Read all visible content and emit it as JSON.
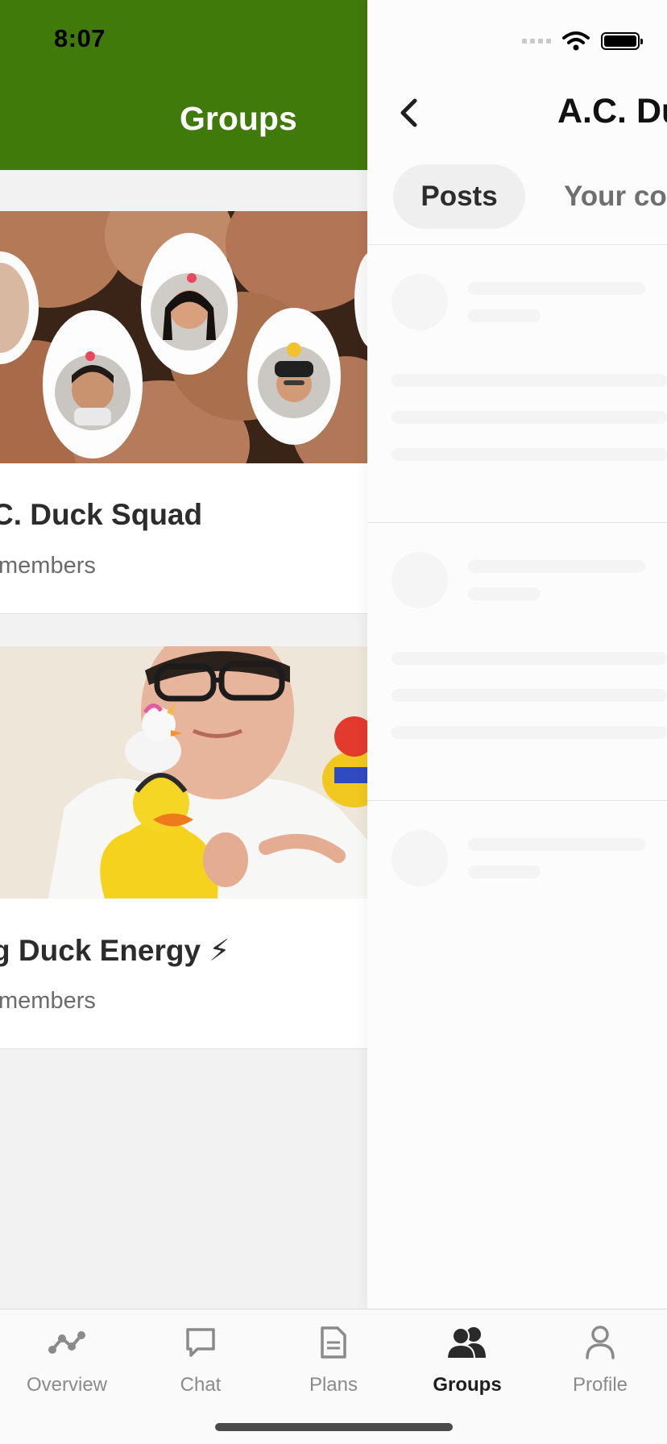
{
  "status_bar": {
    "time": "8:07"
  },
  "groups_screen": {
    "title": "Groups",
    "groups": [
      {
        "name": "C. Duck Squad",
        "members": "members"
      },
      {
        "name": "g Duck Energy ⚡",
        "members": "members"
      }
    ]
  },
  "group_detail": {
    "title": "A.C. Du",
    "tabs": [
      {
        "label": "Posts",
        "active": true
      },
      {
        "label": "Your co",
        "active": false
      }
    ]
  },
  "tabbar": {
    "items": [
      {
        "label": "Overview",
        "icon": "overview-icon"
      },
      {
        "label": "Chat",
        "icon": "chat-icon"
      },
      {
        "label": "Plans",
        "icon": "plans-icon"
      },
      {
        "label": "Groups",
        "icon": "groups-icon",
        "active": true
      },
      {
        "label": "Profile",
        "icon": "profile-icon"
      }
    ]
  },
  "colors": {
    "header_green": "#3f7a0a",
    "active_text": "#1e1e1e",
    "inactive_text": "#8a8a8a"
  }
}
